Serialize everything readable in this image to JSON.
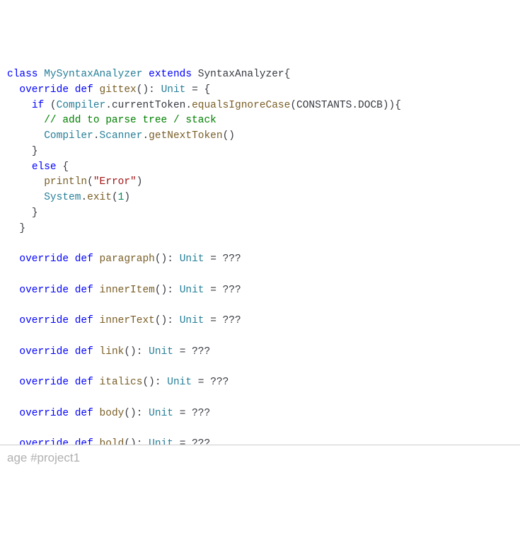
{
  "code": {
    "line1": {
      "kw1": "class",
      "cls1": "MySyntaxAnalyzer",
      "kw2": "extends",
      "cls2": "SyntaxAnalyzer",
      "brace": "{"
    },
    "line2": {
      "kw1": "override",
      "kw2": "def",
      "fn": "gittex",
      "parens": "()",
      "colon": ":",
      "type": "Unit",
      "eq": "=",
      "brace": "{"
    },
    "line3": {
      "kw": "if",
      "open": "(",
      "obj": "Compiler",
      "dot1": ".",
      "prop1": "currentToken",
      "dot2": ".",
      "fn": "equalsIgnoreCase",
      "open2": "(",
      "const1": "CONSTANTS",
      "dot3": ".",
      "const2": "DOCB",
      "close": "))",
      "brace": "{"
    },
    "line4": {
      "cmt": "// add to parse tree / stack"
    },
    "line5": {
      "obj1": "Compiler",
      "dot1": ".",
      "obj2": "Scanner",
      "dot2": ".",
      "fn": "getNextToken",
      "parens": "()"
    },
    "line6": {
      "brace": "}"
    },
    "line7": {
      "kw": "else",
      "brace": "{"
    },
    "line8": {
      "fn": "println",
      "open": "(",
      "str": "\"Error\"",
      "close": ")"
    },
    "line9": {
      "obj": "System",
      "dot": ".",
      "fn": "exit",
      "open": "(",
      "num": "1",
      "close": ")"
    },
    "line10": {
      "brace": "}"
    },
    "line11": {
      "brace": "}"
    },
    "methods": [
      {
        "fn": "paragraph"
      },
      {
        "fn": "innerItem"
      },
      {
        "fn": "innerText"
      },
      {
        "fn": "link"
      },
      {
        "fn": "italics"
      },
      {
        "fn": "body"
      },
      {
        "fn": "bold"
      }
    ],
    "override_kw": "override",
    "def_kw": "def",
    "unit_type": "Unit",
    "parens": "()",
    "colon": ":",
    "eq": "=",
    "qqq": "???"
  },
  "footer": {
    "text": "age #project1"
  }
}
